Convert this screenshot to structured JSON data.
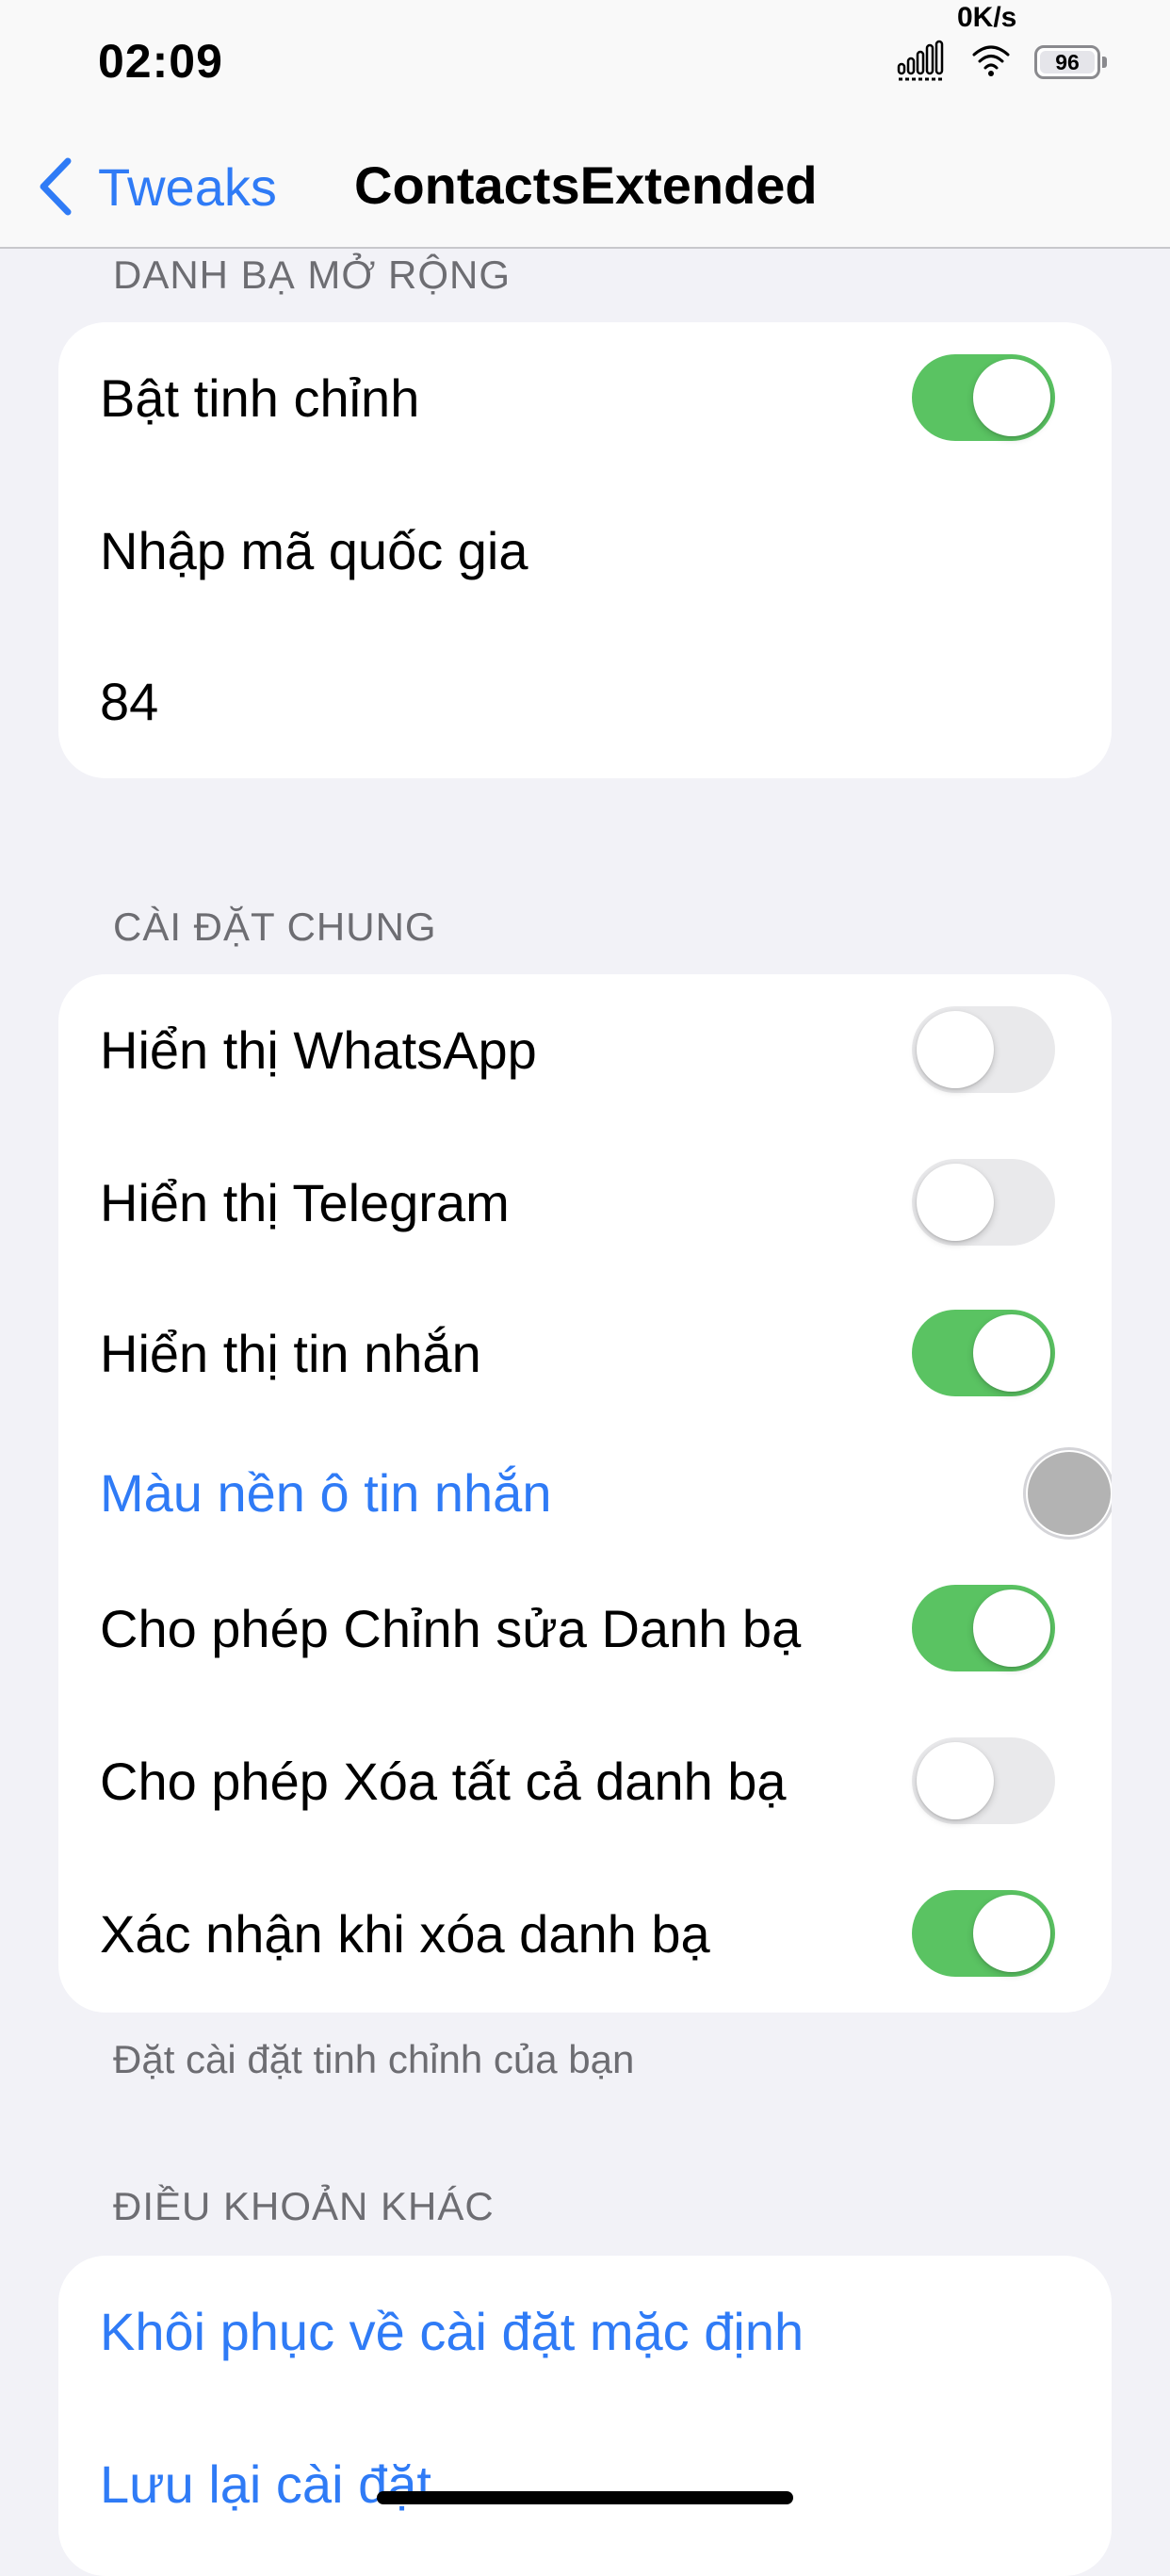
{
  "status_bar": {
    "time": "02:09",
    "net_speed": "0K/s",
    "battery_level": "96",
    "icons": [
      "signal-icon",
      "wifi-icon",
      "battery-icon"
    ]
  },
  "nav": {
    "back_label": "Tweaks",
    "title": "ContactsExtended",
    "back_icon": "chevron-left-icon"
  },
  "sections": {
    "contacts_extended": {
      "header": "DANH BẠ MỞ RỘNG",
      "enable_label": "Bật tinh chỉnh",
      "enable_on": true,
      "country_code_label": "Nhập mã quốc gia",
      "country_code_value": "84"
    },
    "general": {
      "header": "CÀI ĐẶT CHUNG",
      "rows": [
        {
          "label": "Hiển thị WhatsApp",
          "on": false
        },
        {
          "label": "Hiển thị Telegram",
          "on": false
        },
        {
          "label": "Hiển thị tin nhắn",
          "on": true
        },
        {
          "label": "Màu nền ô tin nhắn",
          "color": "#b3b3b3"
        },
        {
          "label": "Cho phép Chỉnh sửa Danh bạ",
          "on": true
        },
        {
          "label": "Cho phép Xóa tất cả danh bạ",
          "on": false
        },
        {
          "label": "Xác nhận khi xóa danh bạ",
          "on": true
        }
      ],
      "footer": "Đặt cài đặt tinh chỉnh của bạn"
    },
    "other": {
      "header": "ĐIỀU KHOẢN KHÁC",
      "reset_label": "Khôi phục về cài đặt mặc định",
      "save_label": "Lưu lại cài đặt"
    }
  },
  "colors": {
    "accent": "#2f7bf6",
    "toggle_on": "#5ac362",
    "toggle_off": "#e9e9eb",
    "background": "#f2f2f7"
  }
}
